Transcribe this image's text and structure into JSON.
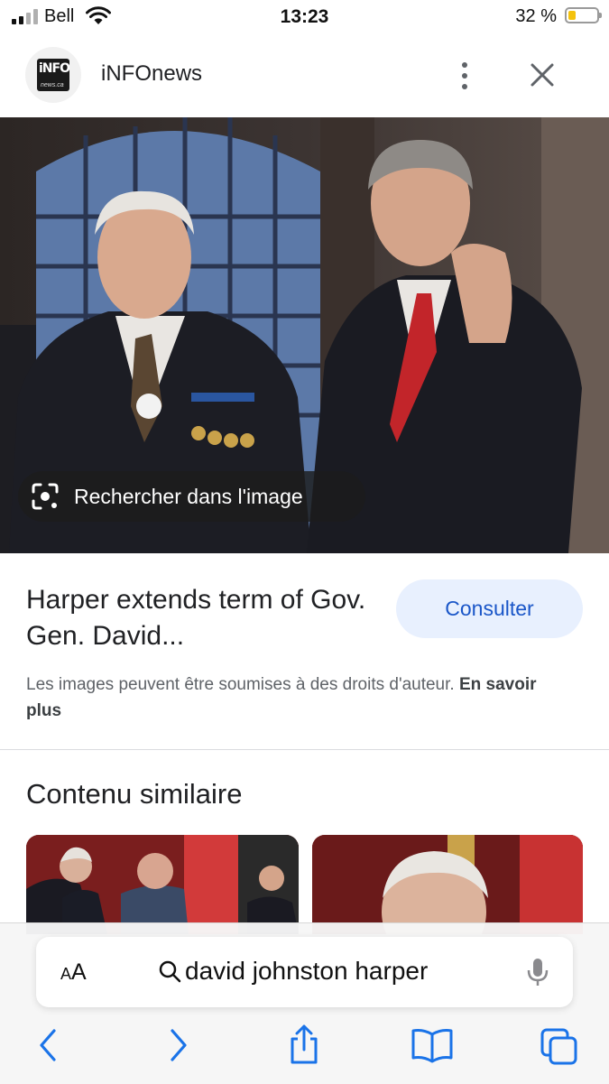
{
  "status_bar": {
    "carrier": "Bell",
    "time": "13:23",
    "battery_percent": "32 %",
    "battery_level": 0.32,
    "signal_bars": 2
  },
  "source": {
    "name": "iNFOnews",
    "logo_text": "iNFO",
    "logo_sub": "news.ca"
  },
  "image_actions": {
    "lens_label": "Rechercher dans l'image"
  },
  "result": {
    "title": "Harper extends term of Gov. Gen. David...",
    "visit_label": "Consulter",
    "copyright_text": "Les images peuvent être soumises à des droits d'auteur. ",
    "learn_more": "En savoir plus"
  },
  "similar": {
    "title": "Contenu similaire"
  },
  "browser": {
    "text_size_small": "A",
    "text_size_large": "A",
    "query": "david johnston harper"
  },
  "colors": {
    "accent": "#1a56c8",
    "button_bg": "#e8f0fe",
    "safari_blue": "#1a73e8"
  }
}
